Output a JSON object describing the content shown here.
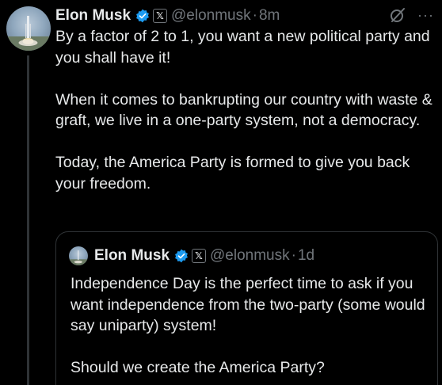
{
  "post": {
    "author_name": "Elon Musk",
    "handle": "@elonmusk",
    "separator": "·",
    "time": "8m",
    "more_label": "···",
    "text": "By a factor of 2 to 1, you want a new political party and you shall have it!\n\nWhen it comes to bankrupting our country with waste & graft, we live in a one-party system, not a democracy.\n\nToday, the America Party is formed to give you back your freedom."
  },
  "quoted_post": {
    "author_name": "Elon Musk",
    "handle": "@elonmusk",
    "separator": "·",
    "time": "1d",
    "text": "Independence Day is the perfect time to ask if you want independence from the two-party (some would say uniparty) system!\n\nShould we create the America Party?"
  },
  "icons": {
    "verified": "verified-badge-icon",
    "affiliate": "x-logo-icon",
    "grok": "grok-icon",
    "more": "more-icon",
    "x_glyph": "𝕏"
  },
  "colors": {
    "background": "#000000",
    "text": "#e7e9ea",
    "muted": "#71767b",
    "verified_blue": "#1d9bf0",
    "border": "#2f3336"
  }
}
